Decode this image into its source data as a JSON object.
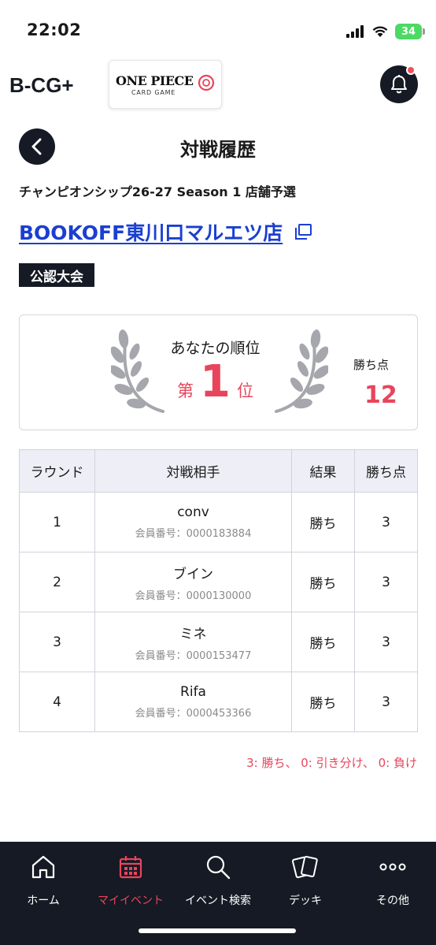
{
  "status_bar": {
    "time": "22:02",
    "battery": "34"
  },
  "header": {
    "brand_logo_text": "B-CG+",
    "game_logo_title": "ONE PIECE",
    "game_logo_subtitle": "CARD GAME"
  },
  "page": {
    "title": "対戦履歴",
    "event_name": "チャンピオンシップ26-27 Season 1 店舗予選",
    "store_name": "BOOKOFF東川口マルエツ店",
    "badge": "公認大会"
  },
  "rank_card": {
    "label": "あなたの順位",
    "prefix": "第",
    "rank": "1",
    "suffix": "位",
    "points_label": "勝ち点",
    "points_value": "12"
  },
  "table": {
    "headers": [
      "ラウンド",
      "対戦相手",
      "結果",
      "勝ち点"
    ],
    "id_prefix": "会員番号：",
    "rows": [
      {
        "round": "1",
        "opponent": "conv",
        "member_id": "0000183884",
        "result": "勝ち",
        "points": "3"
      },
      {
        "round": "2",
        "opponent": "ブイン",
        "member_id": "0000130000",
        "result": "勝ち",
        "points": "3"
      },
      {
        "round": "3",
        "opponent": "ミネ",
        "member_id": "0000153477",
        "result": "勝ち",
        "points": "3"
      },
      {
        "round": "4",
        "opponent": "Rifa",
        "member_id": "0000453366",
        "result": "勝ち",
        "points": "3"
      }
    ]
  },
  "legend": "3: 勝ち、 0: 引き分け、 0: 負け",
  "bottom_nav": {
    "items": [
      {
        "label": "ホーム",
        "icon": "home-icon"
      },
      {
        "label": "マイイベント",
        "icon": "calendar-icon",
        "active": true
      },
      {
        "label": "イベント検索",
        "icon": "search-icon"
      },
      {
        "label": "デッキ",
        "icon": "cards-icon"
      },
      {
        "label": "その他",
        "icon": "more-icon"
      }
    ]
  },
  "colors": {
    "accent": "#e8455c",
    "dark": "#151a24",
    "link": "#1a3fd0",
    "table_header": "#eeeef6"
  }
}
